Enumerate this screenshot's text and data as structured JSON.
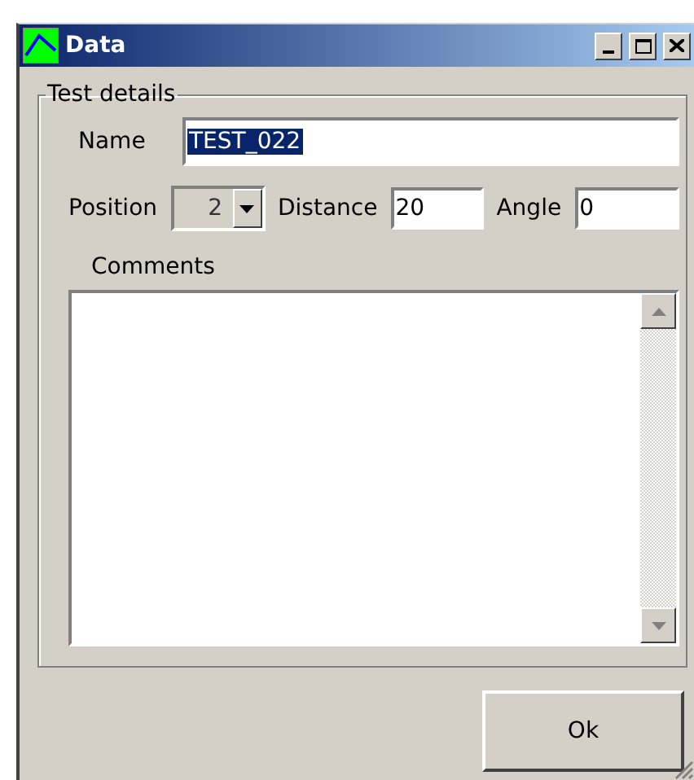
{
  "window": {
    "title": "Data"
  },
  "group": {
    "title": "Test details"
  },
  "name": {
    "label": "Name",
    "value": "TEST_022",
    "selected": true
  },
  "position": {
    "label": "Position",
    "value": "2"
  },
  "distance": {
    "label": "Distance",
    "value": "20"
  },
  "angle": {
    "label": "Angle",
    "value": "0"
  },
  "comments": {
    "label": "Comments"
  },
  "buttons": [
    "Ok"
  ]
}
